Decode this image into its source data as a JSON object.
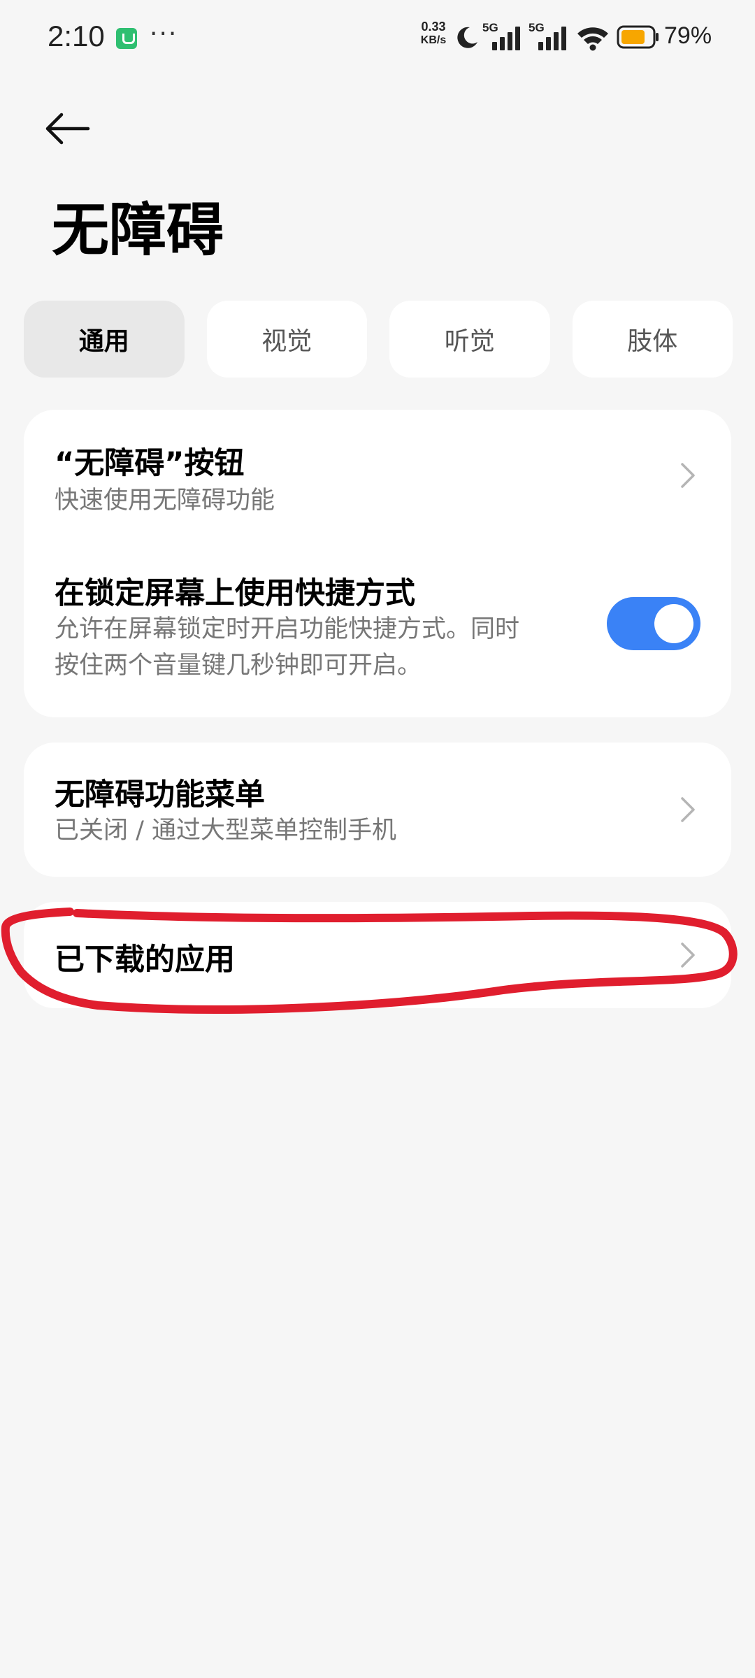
{
  "status_bar": {
    "time": "2:10",
    "dots": "···",
    "net_speed_value": "0.33",
    "net_speed_unit": "KB/s",
    "signal_1_label": "5G",
    "signal_2_label": "5G",
    "battery_level": 0.79,
    "battery_percent": "79%",
    "battery_color": "#f7a600",
    "app_icon_color": "#2fbf71"
  },
  "header": {
    "back_icon": "arrow-left-icon",
    "title": "无障碍"
  },
  "tabs": [
    {
      "label": "通用",
      "active": true
    },
    {
      "label": "视觉",
      "active": false
    },
    {
      "label": "听觉",
      "active": false
    },
    {
      "label": "肢体",
      "active": false
    }
  ],
  "cards": {
    "shortcut_button": {
      "title": "“无障碍”按钮",
      "subtitle": "快速使用无障碍功能"
    },
    "lockscreen_shortcut": {
      "title": "在锁定屏幕上使用快捷方式",
      "subtitle_line1": "允许在屏幕锁定时开启功能快捷方式。同时",
      "subtitle_line2": "按住两个音量键几秒钟即可开启。",
      "enabled": true
    },
    "accessibility_menu": {
      "title": "无障碍功能菜单",
      "subtitle": "已关闭 / 通过大型菜单控制手机"
    },
    "downloaded_apps": {
      "title": "已下载的应用"
    }
  },
  "colors": {
    "background": "#f6f6f6",
    "card": "#ffffff",
    "toggle_on": "#3a82f6",
    "annotation": "#e01e2e"
  }
}
